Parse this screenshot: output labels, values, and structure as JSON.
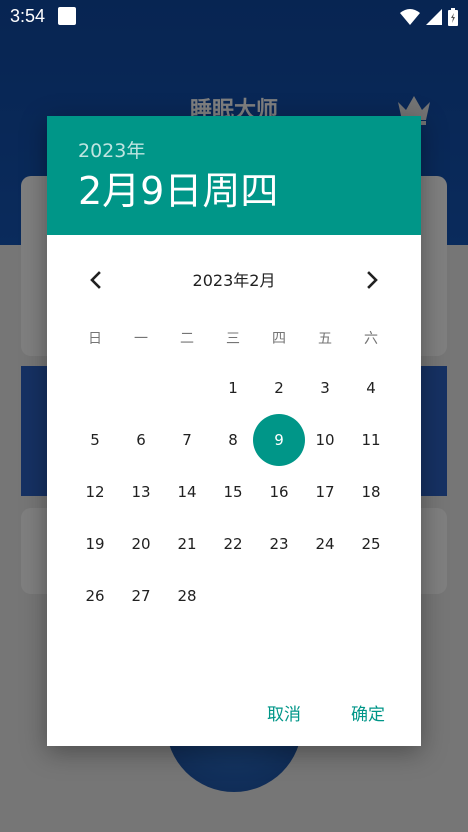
{
  "status_bar": {
    "time": "3:54"
  },
  "background_app": {
    "title": "睡眠大师"
  },
  "dialog": {
    "header_year": "2023年",
    "header_date": "2月9日周四",
    "month_title": "2023年2月",
    "weekdays": [
      "日",
      "一",
      "二",
      "三",
      "四",
      "五",
      "六"
    ],
    "weeks": [
      [
        "",
        "",
        "",
        "1",
        "2",
        "3",
        "4"
      ],
      [
        "5",
        "6",
        "7",
        "8",
        "9",
        "10",
        "11"
      ],
      [
        "12",
        "13",
        "14",
        "15",
        "16",
        "17",
        "18"
      ],
      [
        "19",
        "20",
        "21",
        "22",
        "23",
        "24",
        "25"
      ],
      [
        "26",
        "27",
        "28",
        "",
        "",
        "",
        ""
      ]
    ],
    "selected_day": "9",
    "cancel_label": "取消",
    "ok_label": "确定"
  },
  "colors": {
    "accent": "#009688",
    "app_blue": "#1556b8"
  },
  "icons": [
    "chevron-left-icon",
    "chevron-right-icon",
    "wifi-icon",
    "cell-signal-icon",
    "battery-icon",
    "crown-icon"
  ]
}
